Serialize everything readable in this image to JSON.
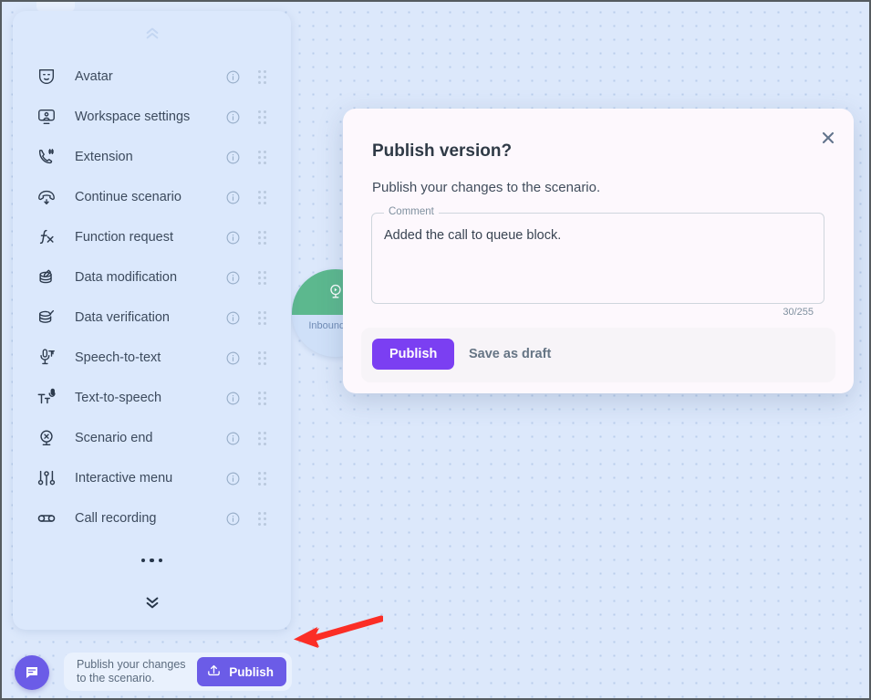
{
  "sidebar": {
    "collapse_icon": "chevron-double-up-icon",
    "expand_icon": "chevron-double-down-icon",
    "more_icon": "more-dots-icon",
    "items": [
      {
        "label": "Avatar",
        "icon": "avatar-mask-icon"
      },
      {
        "label": "Workspace settings",
        "icon": "workspace-monitor-icon"
      },
      {
        "label": "Extension",
        "icon": "phone-hash-icon"
      },
      {
        "label": "Continue scenario",
        "icon": "phone-down-arrow-icon"
      },
      {
        "label": "Function request",
        "icon": "fx-function-icon"
      },
      {
        "label": "Data modification",
        "icon": "database-pencil-icon"
      },
      {
        "label": "Data verification",
        "icon": "database-check-icon"
      },
      {
        "label": "Speech-to-text",
        "icon": "microphone-text-icon"
      },
      {
        "label": "Text-to-speech",
        "icon": "text-microphone-icon"
      },
      {
        "label": "Scenario end",
        "icon": "circle-x-stand-icon"
      },
      {
        "label": "Interactive menu",
        "icon": "sliders-menu-icon"
      },
      {
        "label": "Call recording",
        "icon": "call-recording-icon"
      }
    ],
    "info_icon": "info-circle-icon",
    "grip_icon": "drag-handle-icon"
  },
  "canvas": {
    "node": {
      "label": "Inbound\ncall",
      "icon": "inbound-call-play-icon",
      "head_color": "#5cb88e"
    }
  },
  "modal": {
    "title": "Publish version?",
    "subtitle": "Publish your changes to the scenario.",
    "close_icon": "close-x-icon",
    "comment": {
      "legend": "Comment",
      "value": "Added the call to queue block.",
      "placeholder": "",
      "counter": "30/255"
    },
    "publish_label": "Publish",
    "draft_label": "Save as draft",
    "accent_color": "#7b3ff2"
  },
  "bottom_bar": {
    "chat_icon": "chat-bubble-icon",
    "hint": "Publish your changes\nto the scenario.",
    "publish_label": "Publish",
    "publish_icon": "upload-publish-icon",
    "accent_color": "#6b5ce7"
  },
  "annotation": {
    "arrow_color": "#fb2e26",
    "name": "red-pointer-arrow"
  }
}
